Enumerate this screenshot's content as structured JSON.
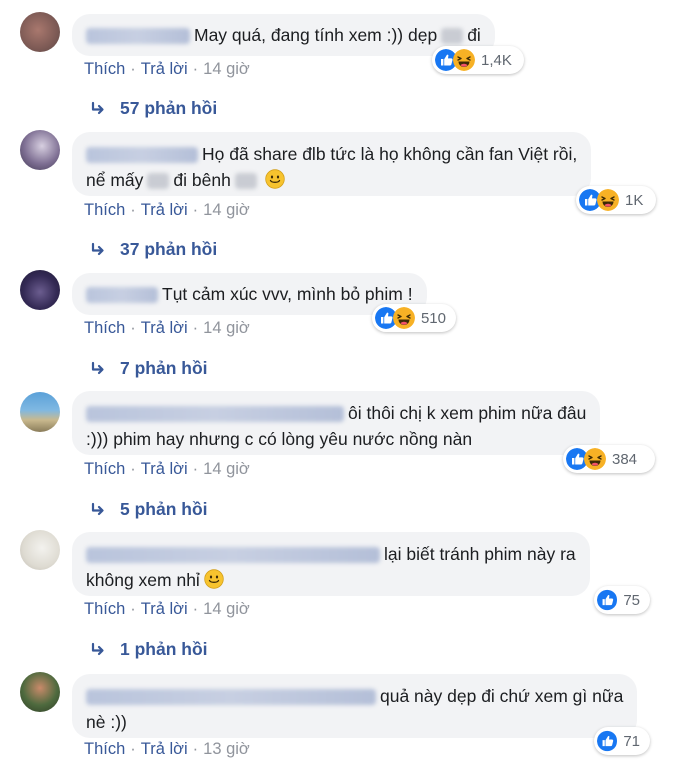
{
  "comments": [
    {
      "text": "May quá, đang tính xem :)) dẹp",
      "text_after": "đi",
      "reaction_count": "1,4K",
      "time": "14 giờ",
      "replies": "57 phản hồi"
    },
    {
      "text": "Họ đã share đlb tức là họ không cần fan Việt rồi,",
      "text_line2a": "nể mấy",
      "text_line2b": "đi bênh",
      "reaction_count": "1K",
      "time": "14 giờ",
      "replies": "37 phản hồi"
    },
    {
      "text": "Tụt cảm xúc vvv, mình bỏ phim !",
      "reaction_count": "510",
      "time": "14 giờ",
      "replies": "7 phản hồi"
    },
    {
      "text": "ôi thôi chị k xem phim nữa đâu",
      "text_line2": ":))) phim hay nhưng c có lòng yêu nước nồng nàn",
      "reaction_count": "384",
      "time": "14 giờ",
      "replies": "5 phản hồi"
    },
    {
      "text": "lại biết tránh phim này ra",
      "text_line2": "không xem nhỉ",
      "reaction_count": "75",
      "time": "14 giờ",
      "replies": "1 phản hồi"
    },
    {
      "text": "quả này dẹp đi chứ xem gì nữa",
      "text_line2": "nè :))",
      "reaction_count": "71",
      "time": "13 giờ"
    }
  ],
  "labels": {
    "like": "Thích",
    "reply": "Trả lời",
    "dot": "·"
  },
  "colors": {
    "link": "#385898",
    "bubble": "#f2f3f5",
    "like": "#1877f2",
    "haha": "#f7b125"
  },
  "icons": [
    "like-reaction-icon",
    "haha-reaction-icon",
    "smile-emoji-icon",
    "reply-arrow-icon"
  ]
}
